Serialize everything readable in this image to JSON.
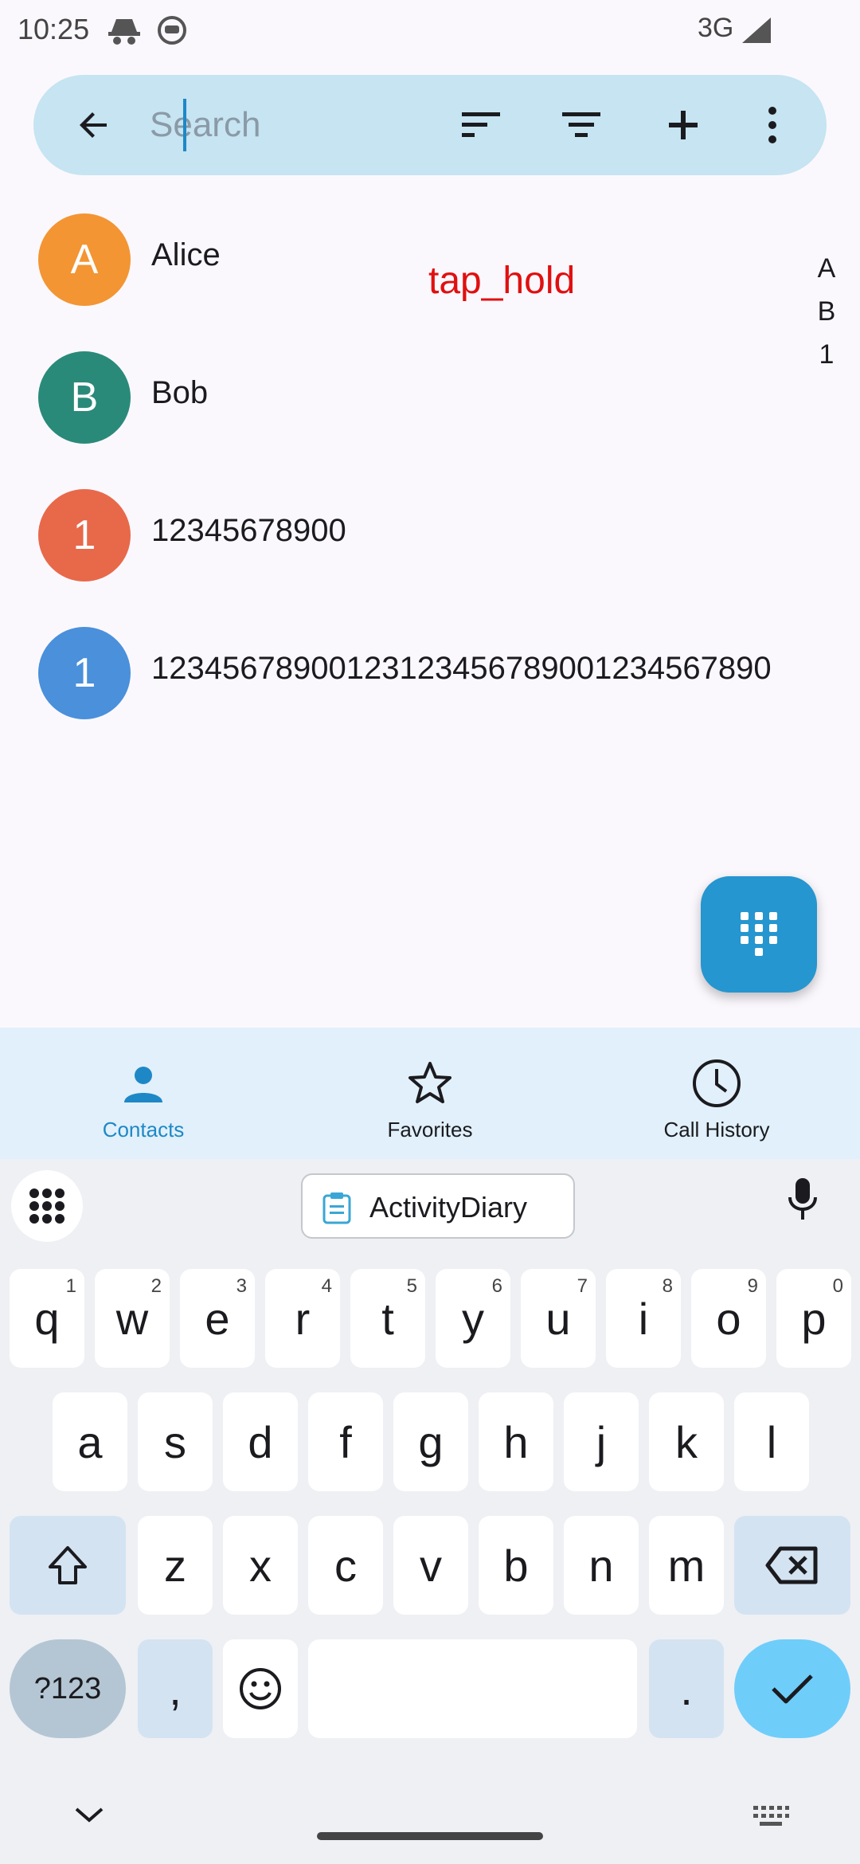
{
  "status_bar": {
    "time": "10:25",
    "network": "3G"
  },
  "search": {
    "placeholder": "Search",
    "value": ""
  },
  "contacts": [
    {
      "initial": "A",
      "name": "Alice",
      "color": "#f39533"
    },
    {
      "initial": "B",
      "name": "Bob",
      "color": "#2a8a7a"
    },
    {
      "initial": "1",
      "name": "12345678900",
      "color": "#e7694a"
    },
    {
      "initial": "1",
      "name": "12345678900123123456789001234567890",
      "color": "#4a90db"
    }
  ],
  "overlay_label": "tap_hold",
  "fast_scroller": [
    "A",
    "B",
    "1"
  ],
  "bottom_nav": [
    {
      "label": "Contacts",
      "icon": "person-icon",
      "active": true
    },
    {
      "label": "Favorites",
      "icon": "star-icon",
      "active": false
    },
    {
      "label": "Call History",
      "icon": "clock-icon",
      "active": false
    }
  ],
  "keyboard": {
    "clipboard_suggestion": "ActivityDiary",
    "row1": [
      {
        "key": "q",
        "hint": "1"
      },
      {
        "key": "w",
        "hint": "2"
      },
      {
        "key": "e",
        "hint": "3"
      },
      {
        "key": "r",
        "hint": "4"
      },
      {
        "key": "t",
        "hint": "5"
      },
      {
        "key": "y",
        "hint": "6"
      },
      {
        "key": "u",
        "hint": "7"
      },
      {
        "key": "i",
        "hint": "8"
      },
      {
        "key": "o",
        "hint": "9"
      },
      {
        "key": "p",
        "hint": "0"
      }
    ],
    "row2": [
      "a",
      "s",
      "d",
      "f",
      "g",
      "h",
      "j",
      "k",
      "l"
    ],
    "row3": [
      "z",
      "x",
      "c",
      "v",
      "b",
      "n",
      "m"
    ],
    "symbols_label": "?123",
    "comma_label": ",",
    "period_label": "."
  },
  "colors": {
    "accent": "#1e88c7",
    "search_bar": "#c6e4f2",
    "nav_bg": "#e1f0fa",
    "fab": "#2596cf"
  }
}
